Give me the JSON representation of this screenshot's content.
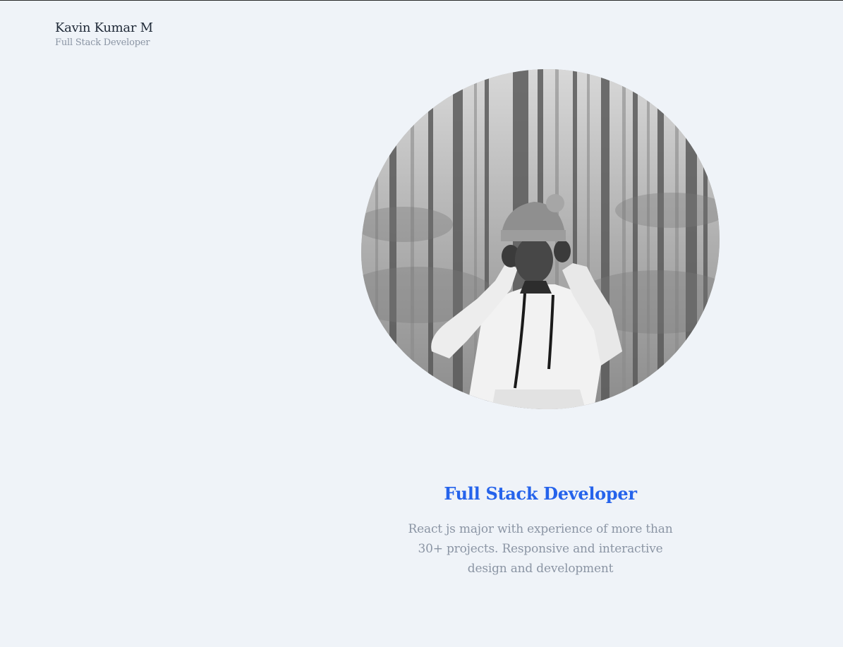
{
  "header": {
    "name": "Kavin Kumar M",
    "role": "Full Stack Developer"
  },
  "portrait": {
    "icon": "profile-photo",
    "description_colors": {
      "background": "#eff3f8",
      "accent": "#2563eb"
    }
  },
  "hero": {
    "title": "Full Stack Developer",
    "description": "React js major with experience of more than 30+ projects. Responsive and interactive design and development"
  }
}
